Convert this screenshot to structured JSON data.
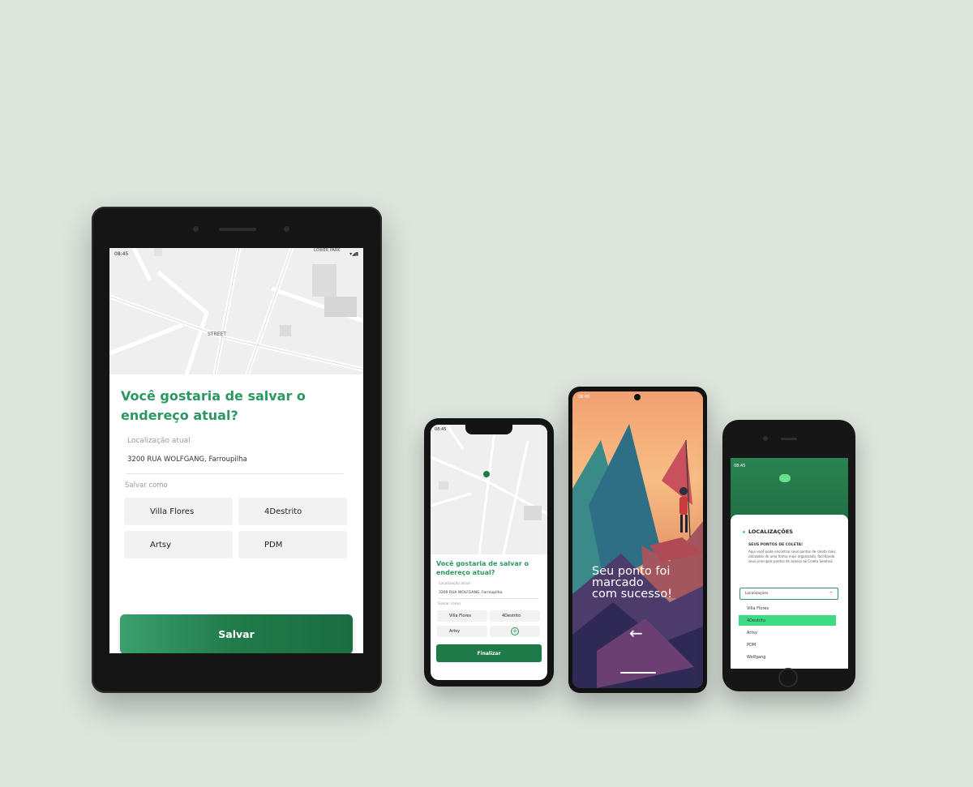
{
  "tablet": {
    "status_time": "08:45",
    "map_label_street": "STREET",
    "map_label_top": "LOWER PARK",
    "title": "Você gostaria de salvar o endereço atual?",
    "location_label": "Localização atual",
    "location_value": "3200 RUA WOLFGANG,  Farroupilha",
    "save_as_label": "Salvar como",
    "options": [
      "Villa Flores",
      "4Destrito",
      "Artsy",
      "PDM"
    ],
    "save_button": "Salvar"
  },
  "phone_a": {
    "status_time": "08:45",
    "title": "Você gostaria de salvar o endereço atual?",
    "location_label": "Localização atual",
    "location_value": "3200 RUA WOLFGANG,  Farroupilha",
    "save_as_label": "Salvar como",
    "options": [
      "Villa Flores",
      "4Destrito",
      "Artsy"
    ],
    "add_label": "+",
    "finish_button": "Finalizar"
  },
  "phone_b": {
    "status_time": "08:45",
    "message_line1": "Seu ponto foi",
    "message_line2": "marcado",
    "message_line3": "com sucesso!",
    "back_arrow": "←"
  },
  "phone_c": {
    "status_time": "08:45",
    "section_title": "LOCALIZAÇÕES",
    "subtitle": "SEUS PONTOS DE COLETA!",
    "description": "Aqui você pode encontrar seus pontos de coleta mais utilizados de uma forma mais organizada, facilitando seus principais pontos de acesso ao Coleta Seletiva.",
    "select_label": "Localizações",
    "items": [
      "Villa Flores",
      "4Destrito",
      "Artsy",
      "PDM",
      "Wolfgang"
    ],
    "selected_index": 1,
    "accent_color": "#3ddc84"
  },
  "colors": {
    "brand_green": "#1f7a4a",
    "title_green": "#2a9860",
    "background": "#dde5dd"
  }
}
